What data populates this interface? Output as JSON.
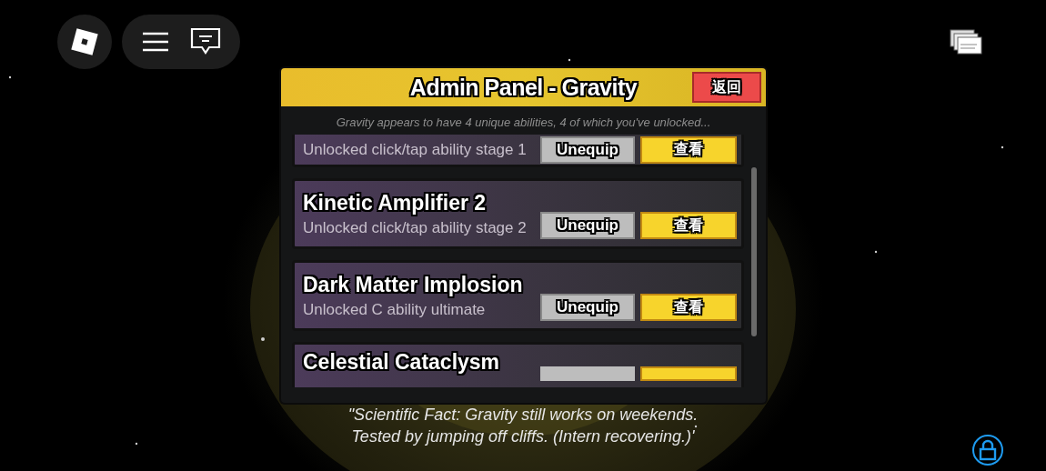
{
  "panel": {
    "title": "Admin Panel - Gravity",
    "back_button": "返回",
    "subtitle": "Gravity appears to have 4 unique abilities, 4 of which you've unlocked..."
  },
  "abilities": [
    {
      "kind": "cut_top",
      "description": "Unlocked click/tap ability stage 1",
      "equip_button": "Unequip",
      "view_button": "查看"
    },
    {
      "kind": "full",
      "name": "Kinetic Amplifier 2",
      "description": "Unlocked click/tap ability stage 2",
      "equip_button": "Unequip",
      "view_button": "查看"
    },
    {
      "kind": "full",
      "name": "Dark Matter Implosion",
      "description": "Unlocked C ability ultimate",
      "equip_button": "Unequip",
      "view_button": "查看"
    },
    {
      "kind": "cut_bottom",
      "name": "Celestial Cataclysm"
    }
  ],
  "quote": [
    "\"Scientific Fact: Gravity still works on weekends.",
    "Tested by jumping off cliffs. (Intern recovering.)'"
  ]
}
